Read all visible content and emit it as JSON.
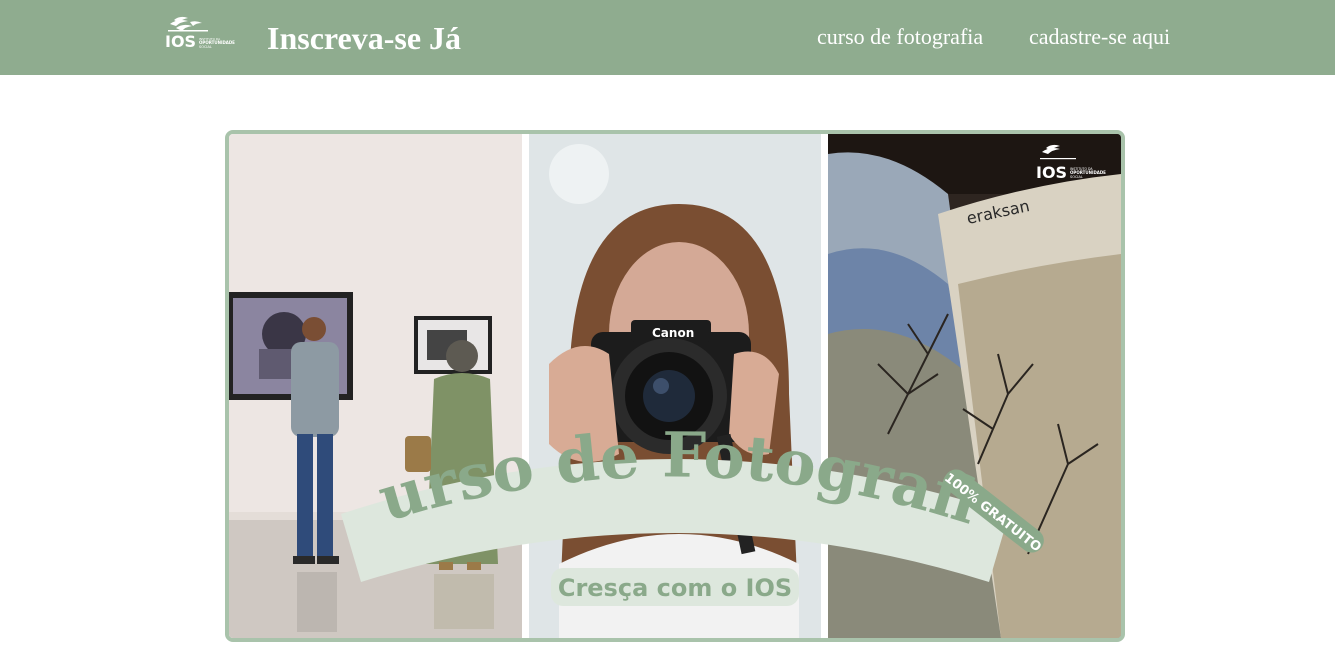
{
  "header": {
    "logo": {
      "text": "IOS",
      "subtext": "INSTITUTO DA OPORTUNIDADE SOCIAL",
      "icon": "ios-logo-icon"
    },
    "title": "Inscreva-se Já",
    "nav": [
      {
        "label": "curso de fotografia"
      },
      {
        "label": "cadastre-se aqui"
      }
    ]
  },
  "banner": {
    "headline": "Curso de Fotografia",
    "tagline": "Cresça com o IOS",
    "badge": "100% GRATUITO",
    "camera_brand": "Canon",
    "book_word": "eraksan",
    "corner_logo": {
      "text": "IOS",
      "subtext": "INSTITUTO DA OPORTUNIDADE SOCIAL"
    },
    "colors": {
      "accent": "#8fac8f",
      "light": "#dde7dd",
      "text_green": "#8aa98a"
    }
  }
}
